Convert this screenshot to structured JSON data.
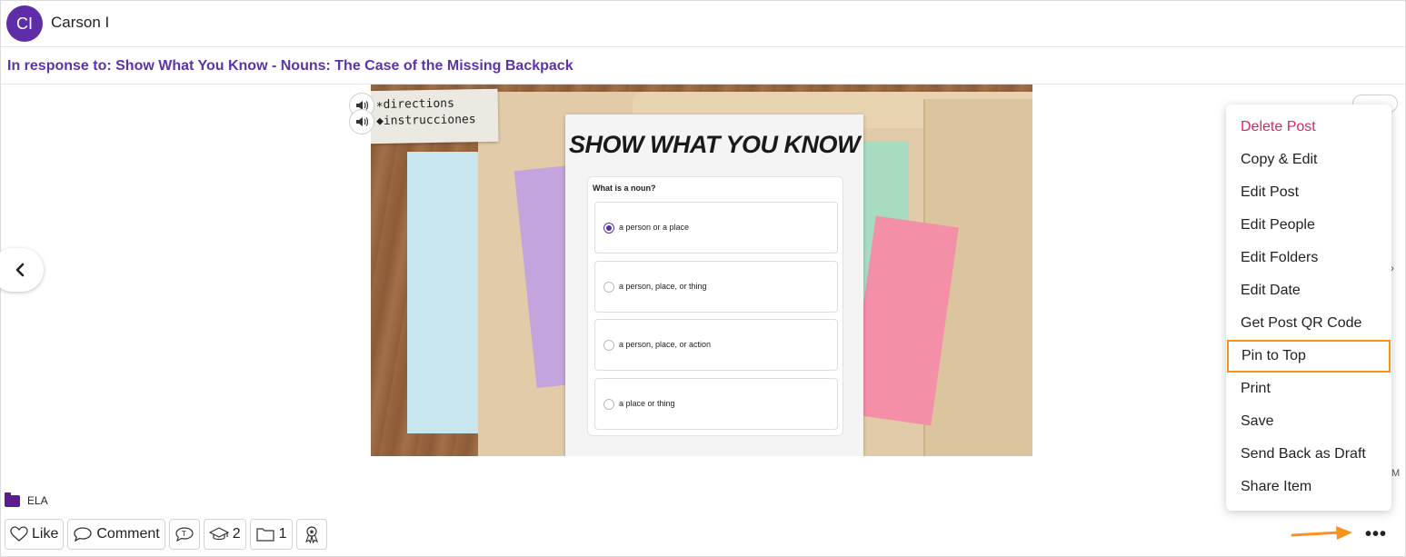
{
  "author": {
    "initials": "CI",
    "name": "Carson I"
  },
  "response": {
    "text": "In response to: Show What You Know - Nouns: The Case of the Missing Backpack"
  },
  "media": {
    "label_lines": [
      "∗directions",
      "◆instrucciones"
    ],
    "sheet_title": "SHOW WHAT YOU KNOW",
    "question": "What is a noun?",
    "options": [
      {
        "text": "a person or a place",
        "selected": true
      },
      {
        "text": "a person, place, or thing",
        "selected": false
      },
      {
        "text": "a person, place, or action",
        "selected": false
      },
      {
        "text": "a place or thing",
        "selected": false
      }
    ],
    "audio_icon": "speaker-icon"
  },
  "nav": {
    "prev_icon": "chevron-left-icon",
    "prev_glyph": "‹"
  },
  "folder_tag": {
    "label": "ELA",
    "color": "#5d1b8e"
  },
  "actions": {
    "like_label": "Like",
    "comment_label": "Comment",
    "translate_glyph": "T",
    "students_count": "2",
    "folders_count": "1",
    "more_glyph": "•••"
  },
  "menu": {
    "items": [
      "Delete Post",
      "Copy & Edit",
      "Edit Post",
      "Edit People",
      "Edit Folders",
      "Edit Date",
      "Get Post QR Code",
      "Pin to Top",
      "Print",
      "Save",
      "Send Back as Draft",
      "Share Item"
    ],
    "highlighted_item": "Pin to Top"
  },
  "colors": {
    "accent": "#5d2ea8",
    "danger": "#e0245e",
    "highlight": "#f7941d"
  },
  "stray": {
    "m": "M"
  }
}
